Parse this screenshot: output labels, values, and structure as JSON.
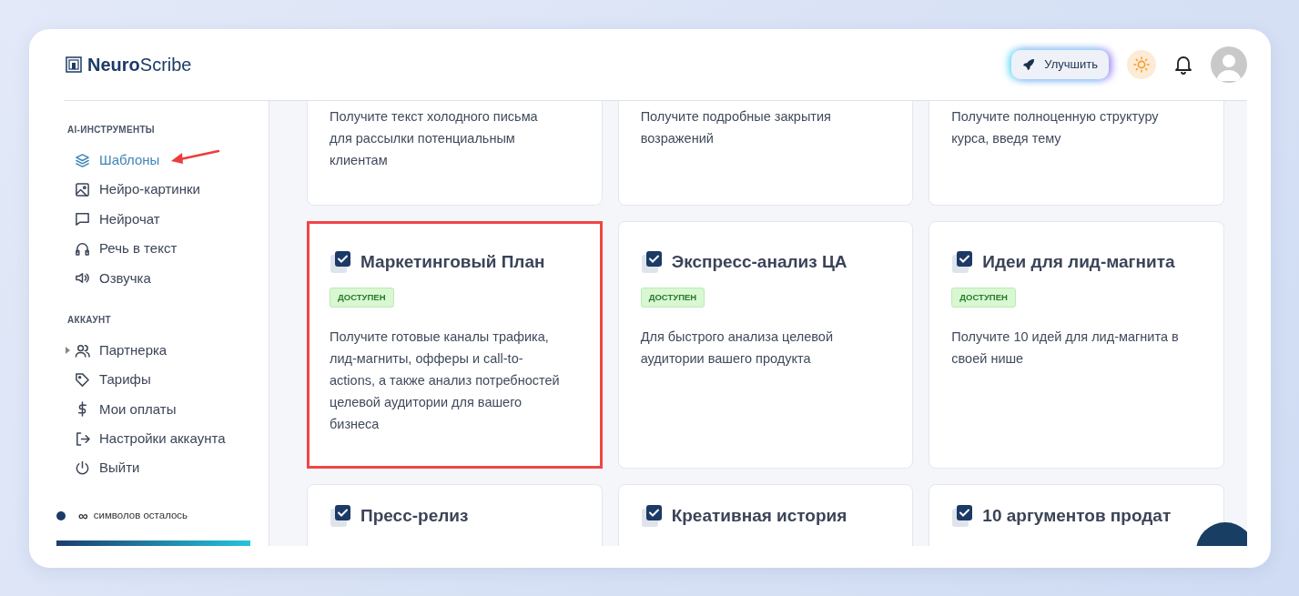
{
  "logo": {
    "bold": "Neuro",
    "rest": "Scribe"
  },
  "header": {
    "upgrade_button": "Улучшить"
  },
  "sidebar": {
    "sections": [
      {
        "heading": "AI-ИНСТРУМЕНТЫ",
        "items": [
          {
            "label": "Шаблоны",
            "selected": true,
            "annotated": true,
            "expandable": false
          },
          {
            "label": "Нейро-картинки",
            "selected": false,
            "annotated": false,
            "expandable": false
          },
          {
            "label": "Нейрочат",
            "selected": false,
            "annotated": false,
            "expandable": false
          },
          {
            "label": "Речь в текст",
            "selected": false,
            "annotated": false,
            "expandable": false
          },
          {
            "label": "Озвучка",
            "selected": false,
            "annotated": false,
            "expandable": false
          }
        ]
      },
      {
        "heading": "АККАУНТ",
        "items": [
          {
            "label": "Партнерка",
            "selected": false,
            "annotated": false,
            "expandable": true
          },
          {
            "label": "Тарифы",
            "selected": false,
            "annotated": false,
            "expandable": false
          },
          {
            "label": "Мои оплаты",
            "selected": false,
            "annotated": false,
            "expandable": false
          },
          {
            "label": "Настройки аккаунта",
            "selected": false,
            "annotated": false,
            "expandable": false
          },
          {
            "label": "Выйти",
            "selected": false,
            "annotated": false,
            "expandable": false
          }
        ]
      }
    ],
    "credits": {
      "count": "∞",
      "label": "символов осталось"
    }
  },
  "cards": [
    {
      "description": "Получите текст холодного письма для рассылки потенциальным клиентам",
      "highlighted": false
    },
    {
      "description": "Получите подробные закрытия возражений",
      "highlighted": false
    },
    {
      "description": "Получите полноценную структуру курса, введя тему",
      "highlighted": false
    },
    {
      "title": "Маркетинговый План",
      "badge": "ДОСТУПЕН",
      "description": "Получите готовые каналы трафика, лид-магниты, офферы и call-to-actions, а также анализ потребностей целевой аудитории для вашего бизнеса",
      "highlighted": true
    },
    {
      "title": "Экспресс-анализ ЦА",
      "badge": "ДОСТУПЕН",
      "description": "Для быстрого анализа целевой аудитории вашего продукта",
      "highlighted": false
    },
    {
      "title": "Идеи для лид-магнита",
      "badge": "ДОСТУПЕН",
      "description": "Получите 10 идей для лид-магнита в своей нише",
      "highlighted": false
    },
    {
      "title": "Пресс-релиз",
      "highlighted": false
    },
    {
      "title": "Креативная история",
      "highlighted": false
    },
    {
      "title": "10 аргументов продат",
      "highlighted": false
    }
  ]
}
